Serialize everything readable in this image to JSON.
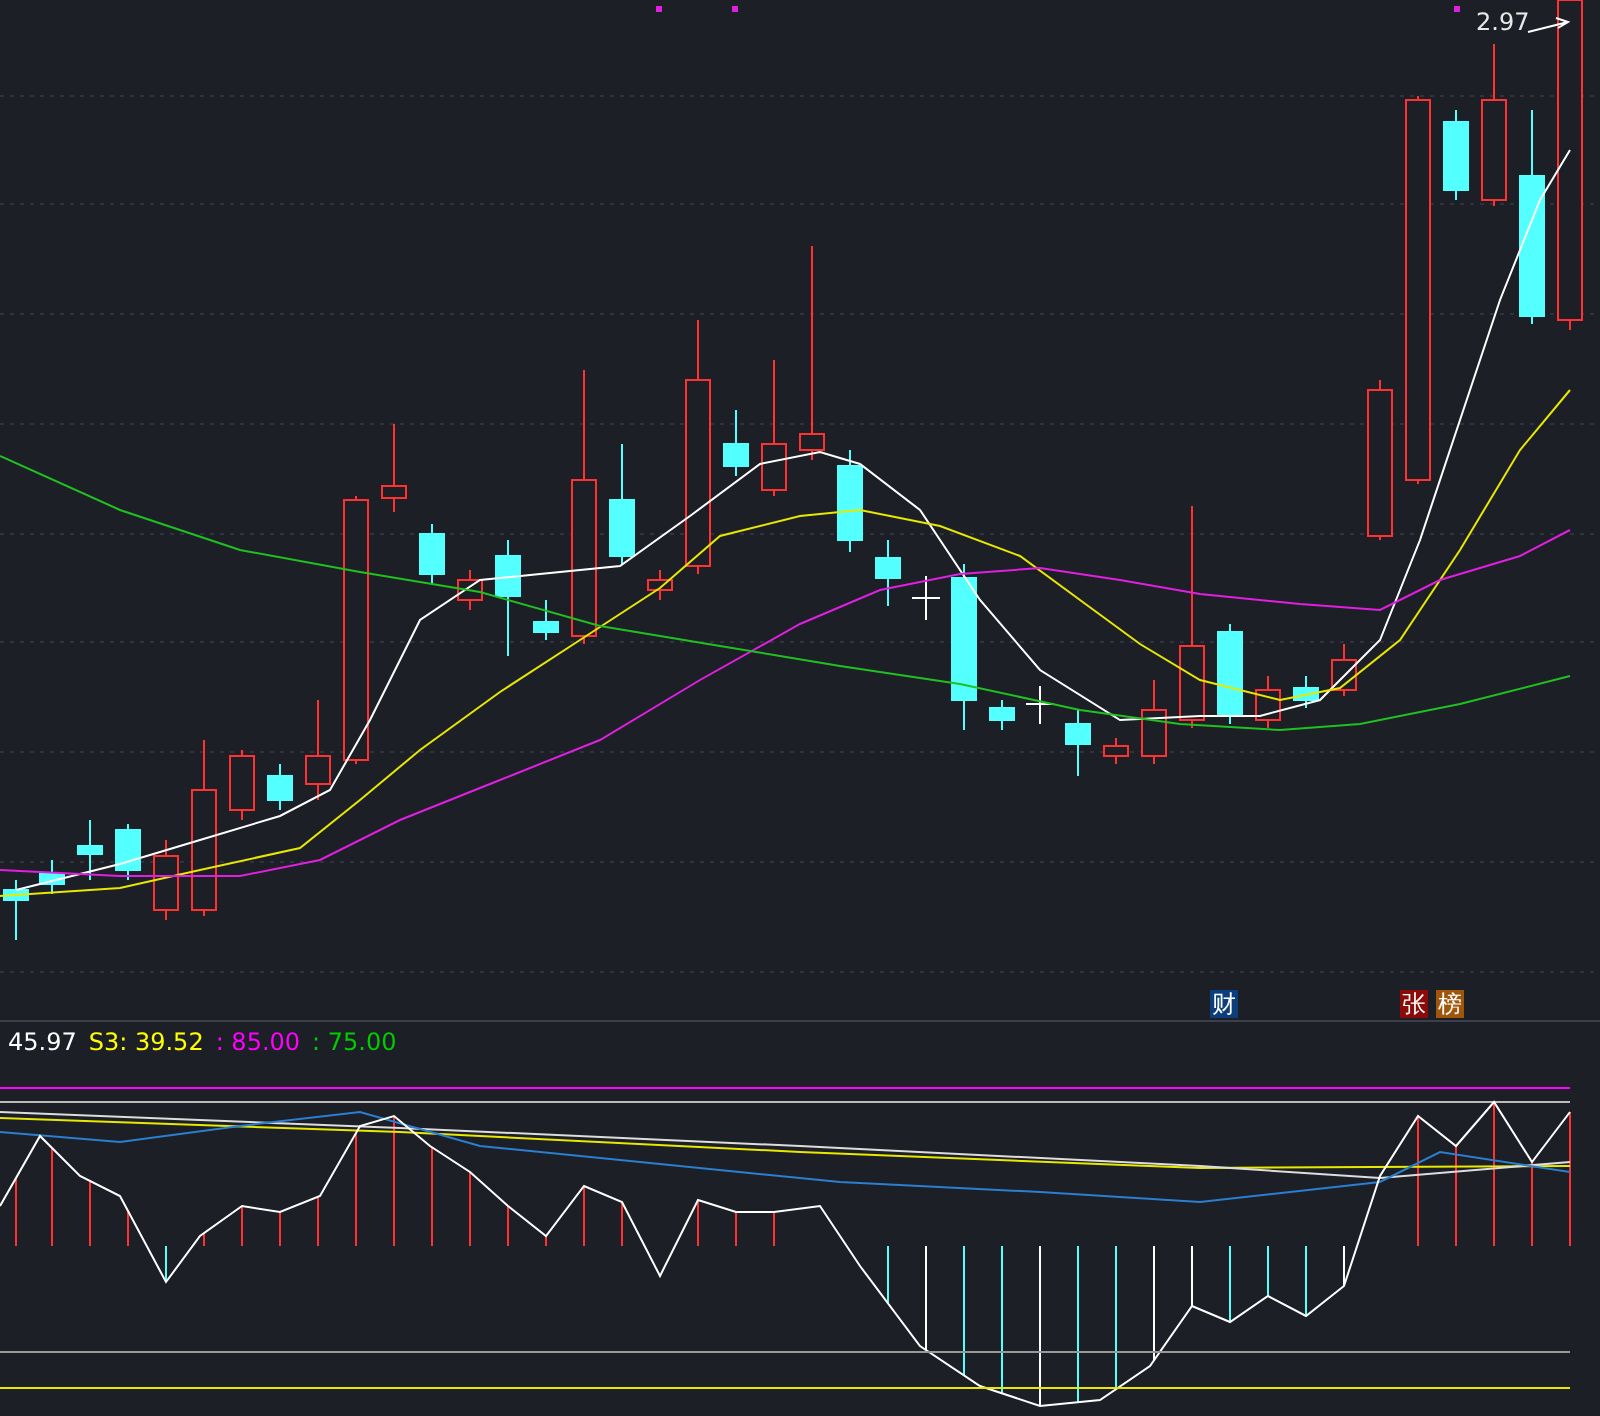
{
  "price_chart": {
    "high_label": "2.97",
    "markers": [
      {
        "text": "财",
        "color": "#0b3e7a"
      },
      {
        "text": "张",
        "color": "#8b0a0a"
      },
      {
        "text": "榜",
        "color": "#a0560a"
      }
    ]
  },
  "indicator": {
    "readings": [
      {
        "text": "45.97",
        "color": "#ffffff"
      },
      {
        "text": "S3: 39.52",
        "color": "#ffff00"
      },
      {
        "text": ": 85.00",
        "color": "#ff00ff"
      },
      {
        "text": ": 75.00",
        "color": "#00cc00"
      }
    ]
  }
}
